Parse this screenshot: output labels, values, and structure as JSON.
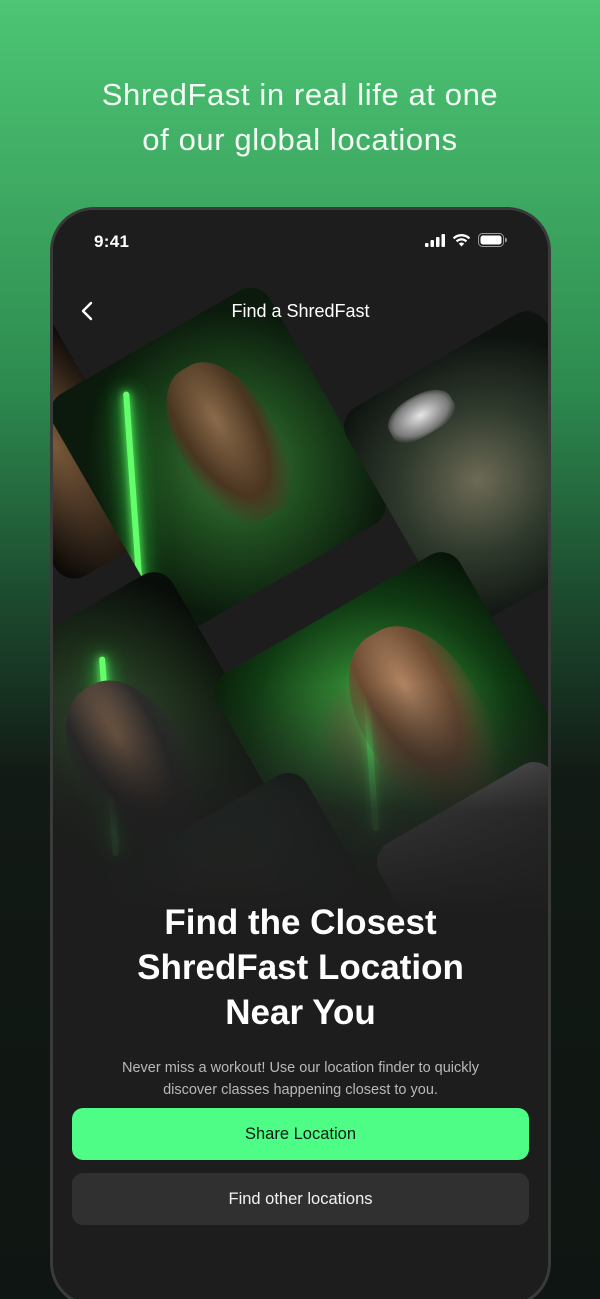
{
  "headline": {
    "line1": "ShredFast in real life at one",
    "line2": "of our global locations"
  },
  "status_bar": {
    "time": "9:41",
    "icons": [
      "cellular-signal-icon",
      "wifi-icon",
      "battery-icon"
    ]
  },
  "nav": {
    "back_icon": "chevron-left-icon",
    "title": "Find a ShredFast"
  },
  "collage": {
    "photos": [
      "gym-photo-athlete-neon",
      "gym-photo-class-spin",
      "gym-photo-trainer",
      "gym-photo-athlete-kneeling",
      "gym-photo-group-class"
    ]
  },
  "main": {
    "title_line1": "Find the Closest",
    "title_line2": "ShredFast Location",
    "title_line3": "Near You",
    "subtitle_line1": "Never miss a workout! Use our location finder to quickly",
    "subtitle_line2": "discover classes happening closest to you.",
    "primary_button": "Share Location",
    "secondary_button": "Find other locations"
  },
  "colors": {
    "accent": "#4dfd85",
    "background_top": "#4cc574",
    "screen_bg": "#1d1d1d",
    "secondary_button_bg": "#303030"
  }
}
